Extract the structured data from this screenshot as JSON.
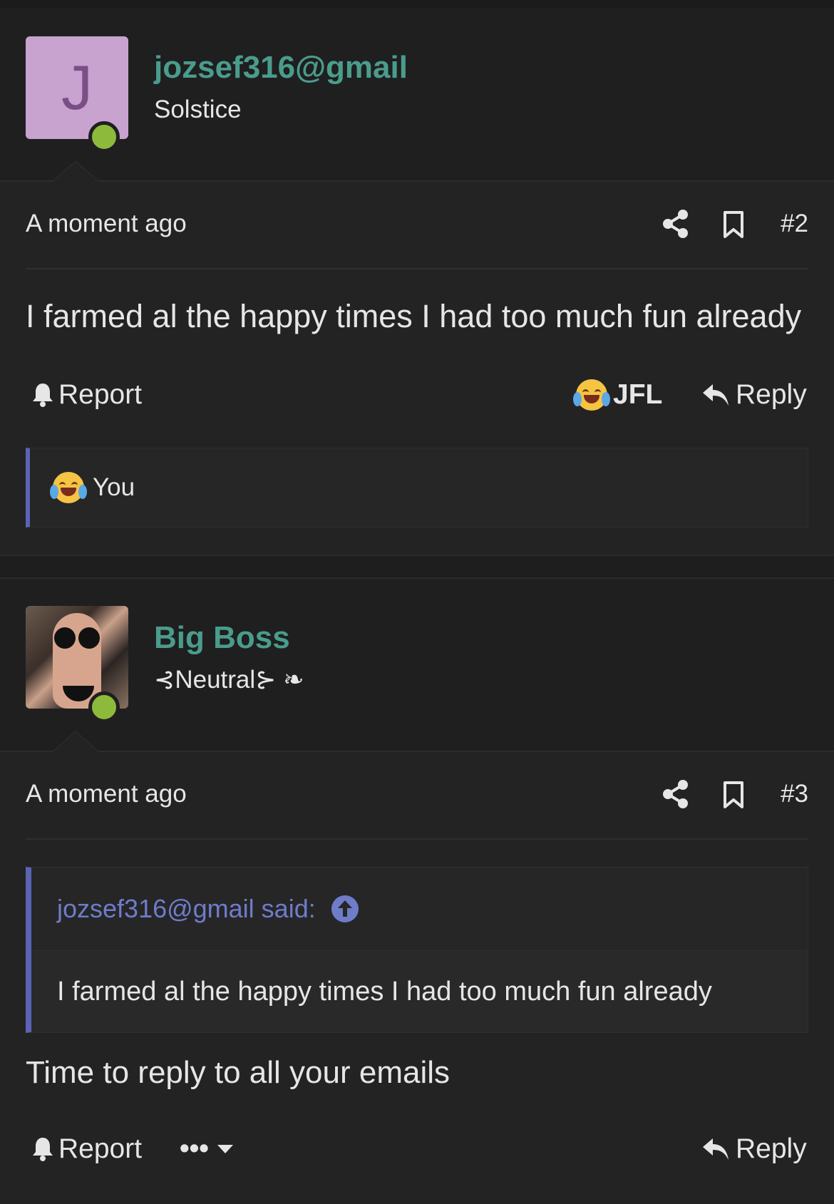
{
  "posts": [
    {
      "avatar_letter": "J",
      "username": "jozsef316@gmail",
      "user_title": "Solstice",
      "time": "A moment ago",
      "post_number": "#2",
      "body": "I farmed al the happy times I had too much fun already",
      "report_label": "Report",
      "reaction_label": "JFL",
      "reply_label": "Reply",
      "reactions_by": "You"
    },
    {
      "username": "Big Boss",
      "user_title": "⊰Neutral⊱ ❧",
      "time": "A moment ago",
      "post_number": "#3",
      "quote_author": "jozsef316@gmail said:",
      "quote_text": "I farmed al the happy times I had too much fun already",
      "body": "Time to reply to all your emails",
      "report_label": "Report",
      "more_label": "•••",
      "reply_label": "Reply"
    }
  ],
  "colors": {
    "background": "#232324",
    "username": "#4a9c8c",
    "online": "#8dba3b",
    "quote_accent": "#5b63b5",
    "quote_link": "#6f7cc9",
    "avatar_bg": "#c9a3d0"
  },
  "icons": [
    "share-icon",
    "bookmark-icon",
    "bell-icon",
    "reply-icon",
    "laughing-crying-emoji",
    "arrow-up-circle-icon",
    "caret-down-icon"
  ]
}
